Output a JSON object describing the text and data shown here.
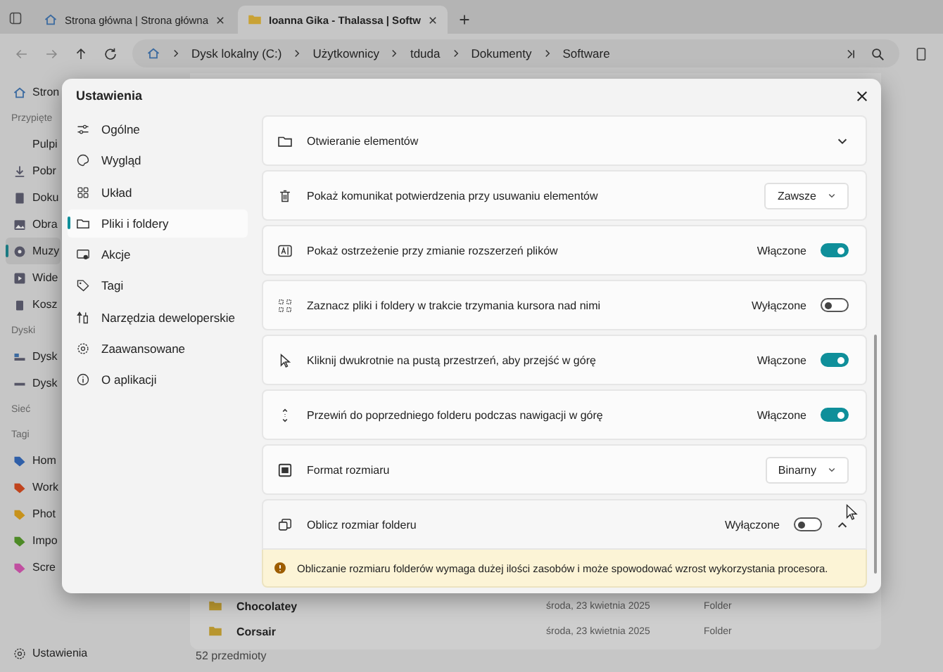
{
  "tabs": [
    {
      "title": "Strona główna | Strona główna",
      "selected": false
    },
    {
      "title": "Ioanna Gika - Thalassa | Softw",
      "selected": true
    }
  ],
  "address": {
    "crumbs": [
      "Dysk lokalny (C:)",
      "Użytkownicy",
      "tduda",
      "Dokumenty",
      "Software"
    ]
  },
  "sidebar": {
    "home": "Stron",
    "sections": [
      {
        "heading": "Przypięte",
        "items": [
          {
            "label": "Pulpi",
            "selected": false
          },
          {
            "label": "Pobr",
            "selected": false
          },
          {
            "label": "Doku",
            "selected": false
          },
          {
            "label": "Obra",
            "selected": false
          },
          {
            "label": "Muzy",
            "selected": true
          },
          {
            "label": "Wide",
            "selected": false
          },
          {
            "label": "Kosz",
            "selected": false
          }
        ]
      },
      {
        "heading": "Dyski",
        "items": [
          {
            "label": "Dysk",
            "selected": false
          },
          {
            "label": "Dysk",
            "selected": false
          }
        ]
      },
      {
        "heading": "Sieć"
      },
      {
        "heading": "Tagi",
        "items": [
          {
            "label": "Hom",
            "color": "#2f5fa8",
            "selected": false
          },
          {
            "label": "Work",
            "color": "#c0441d",
            "selected": false
          },
          {
            "label": "Phot",
            "color": "#c7921b",
            "selected": false
          },
          {
            "label": "Impo",
            "color": "#4d8a26",
            "selected": false
          },
          {
            "label": "Scre",
            "color": "#c04fa0",
            "selected": false
          }
        ]
      }
    ],
    "settings": "Ustawienia"
  },
  "files": [
    {
      "name": "Chocolatey",
      "date": "środa, 23 kwietnia 2025",
      "type": "Folder"
    },
    {
      "name": "Corsair",
      "date": "środa, 23 kwietnia 2025",
      "type": "Folder"
    }
  ],
  "status_bar": "52 przedmioty",
  "dialog": {
    "title": "Ustawienia",
    "nav": [
      {
        "label": "Ogólne",
        "selected": false
      },
      {
        "label": "Wygląd",
        "selected": false
      },
      {
        "label": "Układ",
        "selected": false
      },
      {
        "label": "Pliki i foldery",
        "selected": true
      },
      {
        "label": "Akcje",
        "selected": false
      },
      {
        "label": "Tagi",
        "selected": false
      },
      {
        "label": "Narzędzia deweloperskie",
        "selected": false
      },
      {
        "label": "Zaawansowane",
        "selected": false
      },
      {
        "label": "O aplikacji",
        "selected": false
      }
    ],
    "rows": [
      {
        "kind": "expander",
        "label": "Otwieranie elementów",
        "expanded": false
      },
      {
        "kind": "dropdown",
        "label": "Pokaż komunikat potwierdzenia przy usuwaniu elementów",
        "value": "Zawsze"
      },
      {
        "kind": "toggle",
        "label": "Pokaż ostrzeżenie przy zmianie rozszerzeń plików",
        "on": true,
        "state": "Włączone"
      },
      {
        "kind": "toggle",
        "label": "Zaznacz pliki i foldery w trakcie trzymania kursora nad nimi",
        "on": false,
        "state": "Wyłączone"
      },
      {
        "kind": "toggle",
        "label": "Kliknij dwukrotnie na pustą przestrzeń, aby przejść w górę",
        "on": true,
        "state": "Włączone"
      },
      {
        "kind": "toggle",
        "label": "Przewiń do poprzedniego folderu podczas nawigacji w górę",
        "on": true,
        "state": "Włączone"
      },
      {
        "kind": "dropdown",
        "label": "Format rozmiaru",
        "value": "Binarny"
      },
      {
        "kind": "toggle",
        "label": "Oblicz rozmiar folderu",
        "on": false,
        "state": "Wyłączone",
        "expanded": true,
        "note": "Obliczanie rozmiaru folderów wymaga dużej ilości zasobów i może spowodować wzrost wykorzystania procesora."
      }
    ]
  }
}
